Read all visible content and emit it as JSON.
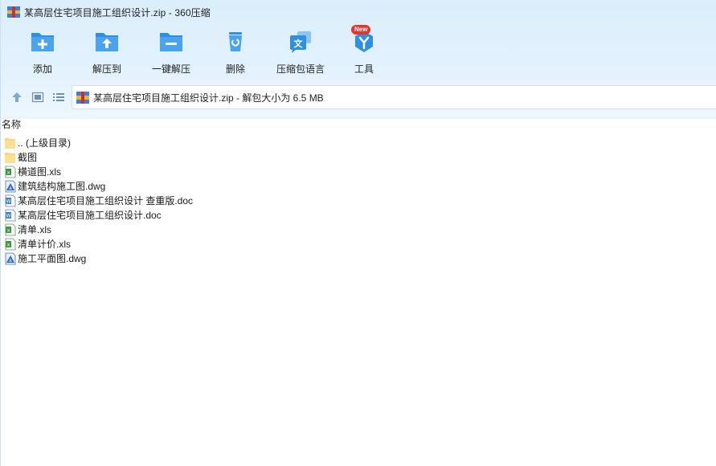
{
  "window": {
    "title": "某高层住宅项目施工组织设计.zip - 360压缩"
  },
  "toolbar": {
    "items": [
      {
        "label": "添加",
        "icon": "add-icon"
      },
      {
        "label": "解压到",
        "icon": "extract-to-icon"
      },
      {
        "label": "一键解压",
        "icon": "one-click-extract-icon"
      },
      {
        "label": "删除",
        "icon": "delete-icon"
      },
      {
        "label": "压缩包语言",
        "icon": "archive-language-icon"
      },
      {
        "label": "工具",
        "icon": "tools-icon",
        "badge": "New"
      }
    ]
  },
  "address": {
    "path": "某高层住宅项目施工组织设计.zip - 解包大小为 6.5 MB"
  },
  "list": {
    "column_name": "名称",
    "files": [
      {
        "name": ".. (上级目录)",
        "type": "folder"
      },
      {
        "name": "截图",
        "type": "folder"
      },
      {
        "name": "横道图.xls",
        "type": "xls"
      },
      {
        "name": "建筑结构施工图.dwg",
        "type": "dwg"
      },
      {
        "name": "某高层住宅项目施工组织设计 查重版.doc",
        "type": "doc"
      },
      {
        "name": "某高层住宅项目施工组织设计.doc",
        "type": "doc"
      },
      {
        "name": "清单.xls",
        "type": "xls"
      },
      {
        "name": "清单计价.xls",
        "type": "xls"
      },
      {
        "name": "施工平面图.dwg",
        "type": "dwg"
      }
    ]
  },
  "colors": {
    "accent_blue": "#2f8fe0",
    "badge_red": "#e8322c",
    "folder_yellow": "#f8d775",
    "xls_green": "#3c9a3c",
    "doc_blue": "#3b7fd0"
  }
}
